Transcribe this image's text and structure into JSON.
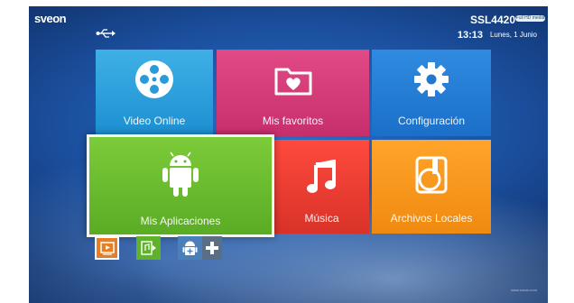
{
  "header": {
    "brand": "sveon",
    "model": "SSL4420",
    "model_badge": "Full HD media",
    "time": "13:13",
    "date": "Lunes, 1 Junio"
  },
  "tiles": {
    "video_online": "Video Online",
    "mis_favoritos": "Mis favoritos",
    "configuracion": "Configuración",
    "mis_aplicaciones": "Mis Aplicaciones",
    "musica": "Música",
    "archivos_locales": "Archivos Locales"
  },
  "footer": {
    "url": "www.sveon.com"
  },
  "colors": {
    "video": "#2ea3df",
    "favorites": "#d83c79",
    "config": "#2580d8",
    "apps": "#6ab92e",
    "music": "#f03a31",
    "files": "#f89519"
  },
  "icons": [
    "usb-icon",
    "film-reel-icon",
    "heart-folder-icon",
    "gear-icon",
    "android-icon",
    "music-note-icon",
    "file-disc-icon",
    "video-play-icon",
    "music-file-icon",
    "android-add-icon",
    "plus-icon"
  ]
}
